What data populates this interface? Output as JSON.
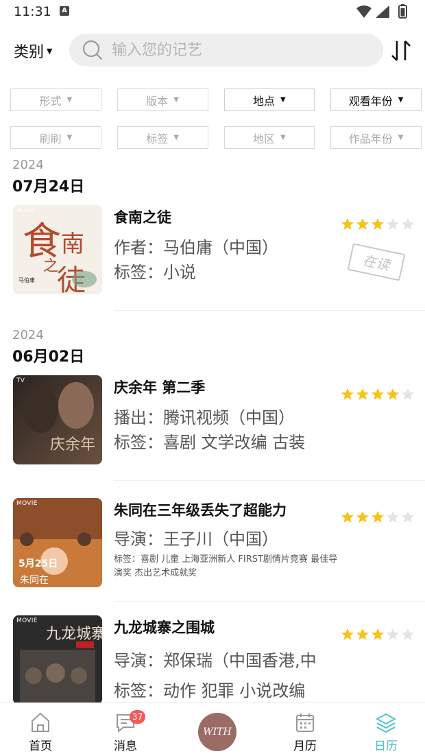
{
  "status_bar": {
    "time": "11:31",
    "notif_icon": "A"
  },
  "search": {
    "category_label": "类别",
    "placeholder": "输入您的记艺"
  },
  "filters": {
    "row1": [
      "形式",
      "版本",
      "地点",
      "观看年份"
    ],
    "row2": [
      "刷刷",
      "标签",
      "地区",
      "作品年份"
    ],
    "active": [
      "地点",
      "观看年份"
    ]
  },
  "groups": [
    {
      "year": "2024",
      "date": "07月24日",
      "entries": [
        {
          "tag": "BOOK",
          "title": "食南之徒",
          "line1": "作者：马伯庸（中国）",
          "line2": "标签：小说",
          "rating": 3,
          "stamp": "在读",
          "poster_text": "食南之徒"
        }
      ]
    },
    {
      "year": "2024",
      "date": "06月02日",
      "entries": [
        {
          "tag": "TV",
          "title": "庆余年 第二季",
          "line1": "播出：腾讯视频（中国）",
          "line2": "标签：喜剧 文学改编 古装",
          "rating": 4,
          "poster_text": "庆余年"
        },
        {
          "tag": "MOVIE",
          "title": "朱同在三年级丢失了超能力",
          "line1": "导演：王子川（中国）",
          "line2_small": "标签：喜剧 儿童 上海亚洲新人 FIRST剧情片竞赛 最佳导演奖 杰出艺术成就奖",
          "rating": 3,
          "poster_text": "5月25日"
        },
        {
          "tag": "MOVIE",
          "title": "九龙城寨之围城",
          "line1": "导演：郑保瑞（中国香港,中",
          "line2": "标签：动作 犯罪 小说改编",
          "rating": 3,
          "poster_text": "九龙城寨"
        }
      ]
    }
  ],
  "nav": {
    "items": [
      "首页",
      "消息",
      "月历",
      "日历"
    ],
    "badge": "37",
    "center": "WITH",
    "active": "日历"
  },
  "colors": {
    "star_on": "#f7c31a",
    "star_off": "#e3e3e3",
    "accent": "#4cc2c8",
    "badge": "#f05a5a",
    "center": "#9b6b66"
  }
}
